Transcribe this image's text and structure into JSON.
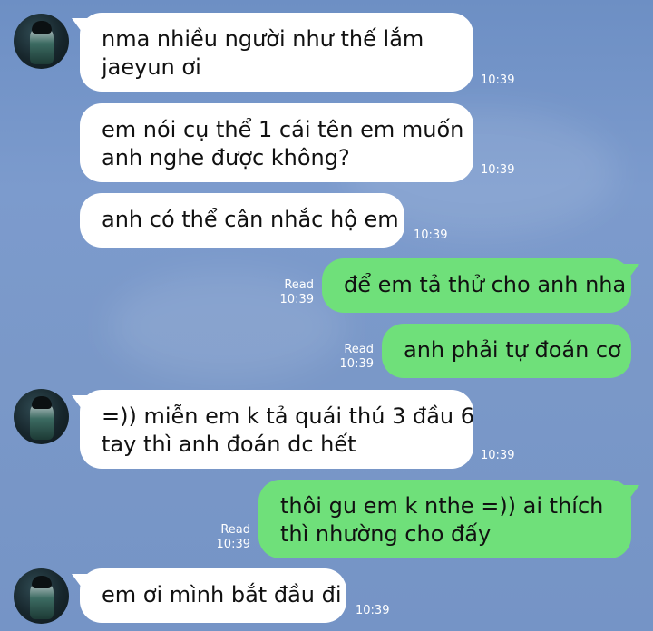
{
  "messages": [
    {
      "lines": [
        "nma nhiều người như thế lắm",
        "jaeyun ơi"
      ],
      "time": "10:39"
    },
    {
      "lines": [
        "em nói cụ thể 1 cái tên em muốn",
        "anh nghe được không?"
      ],
      "time": "10:39"
    },
    {
      "lines": [
        "anh có thể cân nhắc hộ em"
      ],
      "time": "10:39"
    },
    {
      "lines": [
        "để em tả thử cho anh nha"
      ],
      "time": "10:39",
      "read": "Read"
    },
    {
      "lines": [
        "anh phải tự đoán cơ"
      ],
      "time": "10:39",
      "read": "Read"
    },
    {
      "lines": [
        "=)) miễn em k tả quái thú 3 đầu 6",
        "tay thì anh đoán dc hết"
      ],
      "time": "10:39"
    },
    {
      "lines": [
        "thôi gu em k nthe =)) ai thích",
        "thì nhường cho đấy"
      ],
      "time": "10:39",
      "read": "Read"
    },
    {
      "lines": [
        "em ơi mình bắt đầu đi"
      ],
      "time": "10:39"
    }
  ],
  "colors": {
    "incoming": "#ffffff",
    "outgoing": "#6fe07a",
    "background": "#7594c6"
  },
  "icons": {
    "avatar": "contact-avatar"
  }
}
